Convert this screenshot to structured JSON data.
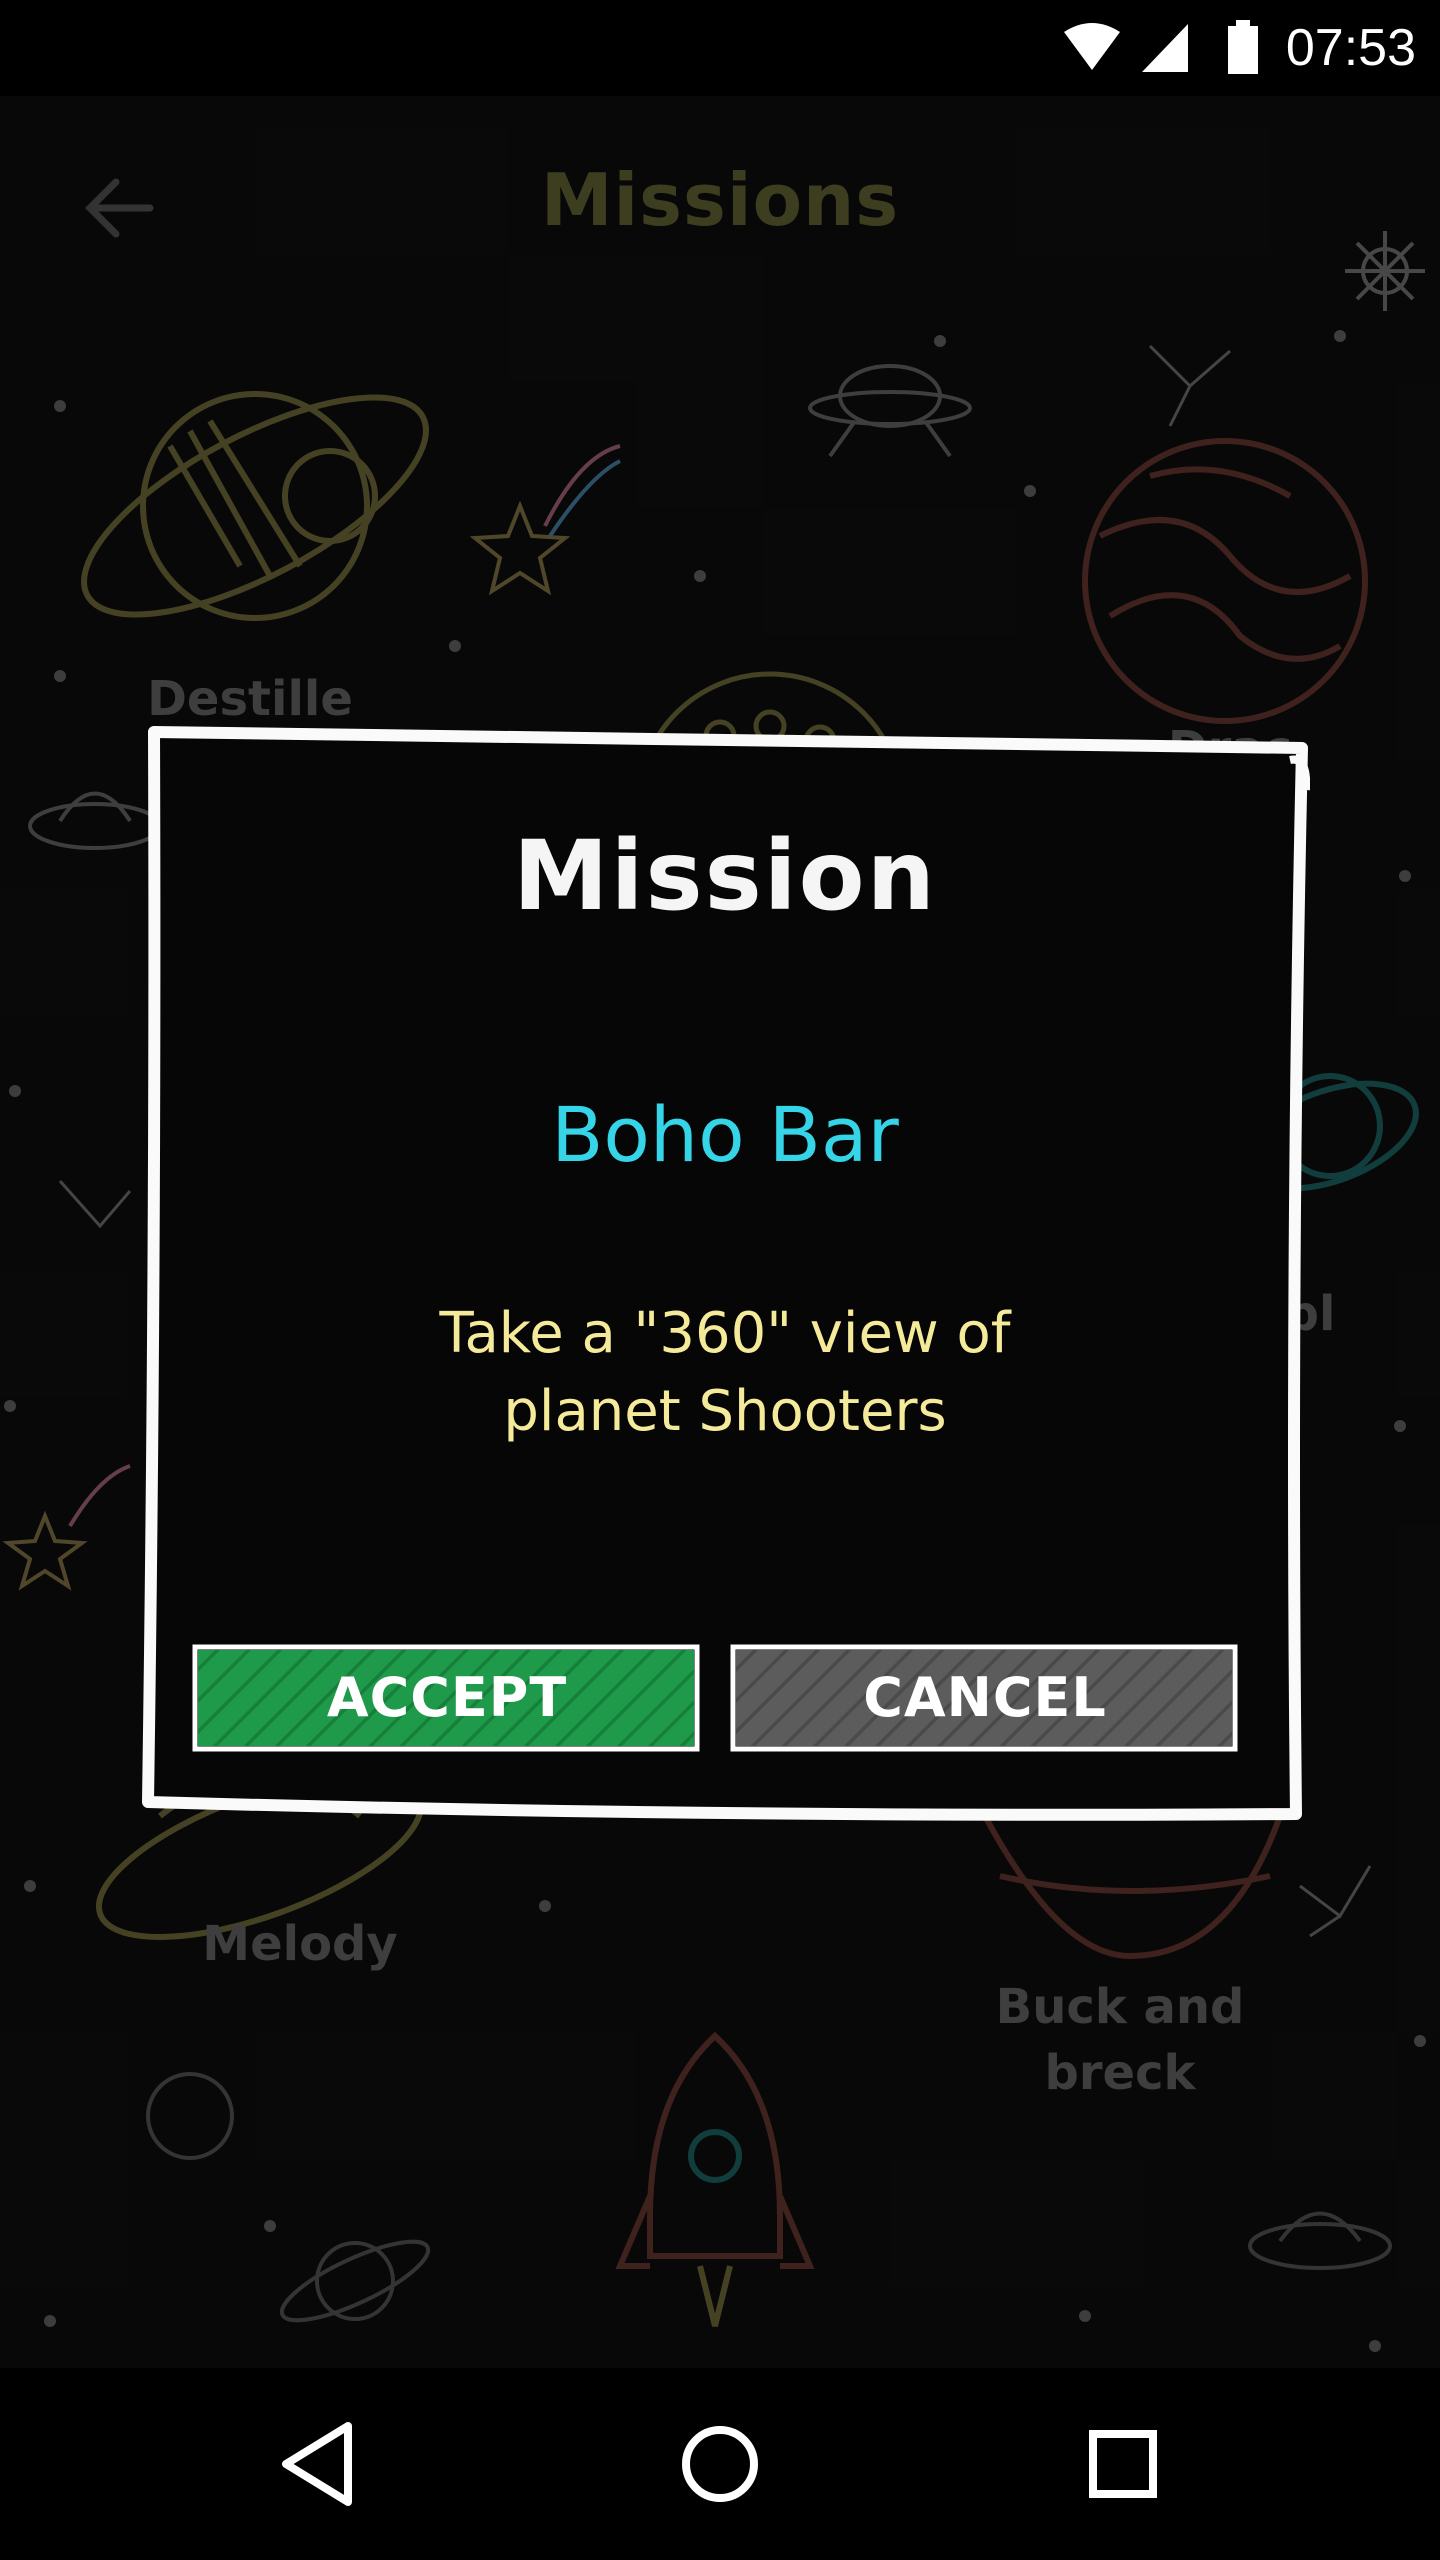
{
  "status_bar": {
    "time": "07:53",
    "icons": [
      "wifi-icon",
      "signal-icon",
      "battery-icon"
    ]
  },
  "app_bar": {
    "title": "Missions",
    "back_icon": "back-arrow-icon"
  },
  "background": {
    "labels": {
      "destille": "Destille",
      "melody": "Melody",
      "buck": "Buck and\nbreck",
      "partial_right_top": "Drac",
      "partial_right_mid": "bl"
    }
  },
  "dialog": {
    "title": "Mission",
    "mission_name": "Boho Bar",
    "description_line1": "Take a \"360\" view of",
    "description_line2": "planet Shooters",
    "accept_label": "ACCEPT",
    "cancel_label": "CANCEL"
  },
  "colors": {
    "accept": "#1e9a4a",
    "cancel": "#5a5a5a",
    "mission_name": "#35d4e6",
    "description": "#f4ea9a",
    "title_dim": "#6a6a38"
  },
  "nav_bar": {
    "icons": [
      "back-triangle-icon",
      "home-circle-icon",
      "recents-square-icon"
    ]
  }
}
